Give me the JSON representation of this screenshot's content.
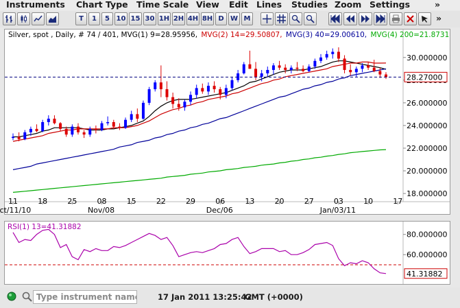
{
  "menu": {
    "items": [
      "Instruments",
      "Chart Type",
      "Time Scale",
      "View",
      "Edit",
      "Lines",
      "Studies",
      "Zoom",
      "Settings"
    ],
    "more": "»"
  },
  "toolbar": {
    "timeframes": [
      "T",
      "1",
      "5",
      "10",
      "15",
      "30",
      "1H",
      "2H",
      "4H",
      "8H",
      "D",
      "W",
      "M"
    ],
    "more": "»"
  },
  "chart_data": [
    {
      "type": "line",
      "subtype": "candlestick-with-moving-averages",
      "title": "Silver, spot , Daily, # 74 / 401",
      "legend": [
        {
          "text": "Silver, spot , Daily, # 74 / 401, MVG(1) 9=28.95956,",
          "color": "#000000"
        },
        {
          "text": "MVG(2) 14=29.50807,",
          "color": "#cc0000"
        },
        {
          "text": "MVG(3) 40=29.00610,",
          "color": "#000099"
        },
        {
          "text": "MVG(4) 200=21.87312",
          "color": "#00aa00"
        }
      ],
      "x_ticks": [
        {
          "major": "Oct/11/10",
          "minor": "11"
        },
        {
          "major": "",
          "minor": "18"
        },
        {
          "major": "",
          "minor": "25"
        },
        {
          "major": "Nov/08",
          "minor": "08"
        },
        {
          "major": "",
          "minor": "15"
        },
        {
          "major": "",
          "minor": "22"
        },
        {
          "major": "",
          "minor": "29"
        },
        {
          "major": "Dec/06",
          "minor": "06"
        },
        {
          "major": "",
          "minor": "13"
        },
        {
          "major": "",
          "minor": "20"
        },
        {
          "major": "",
          "minor": "27"
        },
        {
          "major": "Jan/03/11",
          "minor": "03"
        },
        {
          "major": "",
          "minor": "10"
        },
        {
          "major": "",
          "minor": "17"
        }
      ],
      "y_ticks": [
        "30.000000",
        "28.000000",
        "26.000000",
        "24.000000",
        "22.000000",
        "20.000000",
        "18.000000"
      ],
      "y_tick_values": [
        30,
        28,
        26,
        24,
        22,
        20,
        18
      ],
      "ylim": [
        17.4,
        31.5
      ],
      "last_price_label": "28.27000",
      "last_price": 28.27,
      "candle_colors": {
        "up": "#0000ff",
        "down": "#dd0000"
      },
      "candles": [
        [
          22.9,
          23.3,
          22.7,
          23.0
        ],
        [
          23.0,
          23.4,
          22.6,
          22.8
        ],
        [
          22.8,
          23.6,
          22.7,
          23.4
        ],
        [
          23.4,
          23.9,
          23.1,
          23.7
        ],
        [
          23.7,
          24.1,
          23.4,
          23.5
        ],
        [
          23.5,
          24.5,
          23.4,
          24.3
        ],
        [
          24.3,
          24.9,
          24.0,
          24.6
        ],
        [
          24.6,
          24.9,
          24.1,
          24.2
        ],
        [
          24.2,
          24.3,
          23.5,
          23.7
        ],
        [
          23.7,
          23.9,
          23.0,
          23.2
        ],
        [
          23.2,
          24.1,
          23.0,
          23.9
        ],
        [
          23.9,
          24.2,
          23.2,
          23.4
        ],
        [
          23.4,
          23.6,
          22.9,
          23.2
        ],
        [
          23.2,
          23.9,
          23.0,
          23.7
        ],
        [
          23.7,
          24.0,
          23.3,
          23.6
        ],
        [
          23.6,
          24.4,
          23.5,
          24.2
        ],
        [
          24.2,
          24.8,
          24.0,
          24.3
        ],
        [
          24.3,
          24.5,
          23.7,
          23.9
        ],
        [
          23.9,
          24.2,
          23.6,
          23.8
        ],
        [
          23.8,
          24.7,
          23.7,
          24.5
        ],
        [
          24.5,
          25.3,
          24.3,
          25.0
        ],
        [
          25.0,
          25.5,
          24.3,
          24.6
        ],
        [
          24.6,
          26.2,
          24.5,
          26.0
        ],
        [
          26.0,
          27.4,
          25.8,
          27.2
        ],
        [
          27.2,
          28.0,
          27.0,
          27.8
        ],
        [
          27.8,
          29.3,
          26.5,
          27.2
        ],
        [
          27.2,
          27.9,
          26.2,
          26.5
        ],
        [
          26.5,
          26.9,
          25.5,
          25.9
        ],
        [
          25.9,
          26.4,
          25.3,
          25.6
        ],
        [
          25.6,
          26.3,
          25.3,
          26.1
        ],
        [
          26.1,
          27.0,
          25.8,
          26.7
        ],
        [
          26.7,
          27.6,
          26.4,
          27.3
        ],
        [
          27.3,
          27.7,
          26.8,
          27.0
        ],
        [
          27.0,
          27.8,
          26.7,
          27.5
        ],
        [
          27.5,
          27.9,
          26.9,
          27.2
        ],
        [
          27.2,
          27.4,
          26.3,
          26.7
        ],
        [
          26.7,
          27.6,
          26.4,
          27.3
        ],
        [
          27.3,
          28.3,
          27.1,
          28.0
        ],
        [
          28.0,
          28.9,
          27.8,
          28.6
        ],
        [
          28.6,
          29.6,
          28.5,
          29.4
        ],
        [
          29.4,
          30.6,
          29.0,
          29.0
        ],
        [
          29.0,
          29.6,
          28.0,
          28.3
        ],
        [
          28.3,
          28.9,
          27.9,
          28.6
        ],
        [
          28.6,
          29.2,
          28.3,
          28.9
        ],
        [
          28.9,
          29.5,
          28.5,
          29.3
        ],
        [
          29.3,
          29.7,
          28.9,
          29.1
        ],
        [
          29.1,
          29.4,
          28.6,
          28.9
        ],
        [
          28.9,
          29.3,
          28.6,
          29.1
        ],
        [
          29.1,
          29.6,
          28.8,
          29.0
        ],
        [
          29.0,
          29.3,
          28.7,
          28.8
        ],
        [
          28.8,
          29.4,
          28.7,
          29.2
        ],
        [
          29.2,
          29.9,
          29.0,
          29.7
        ],
        [
          29.7,
          30.3,
          29.5,
          30.0
        ],
        [
          30.0,
          30.6,
          29.8,
          30.3
        ],
        [
          30.3,
          30.8,
          29.9,
          30.5
        ],
        [
          30.5,
          30.9,
          29.6,
          29.9
        ],
        [
          29.9,
          30.2,
          28.6,
          28.9
        ],
        [
          28.9,
          29.4,
          28.4,
          28.7
        ],
        [
          28.7,
          29.2,
          28.3,
          29.0
        ],
        [
          29.0,
          29.5,
          28.7,
          29.3
        ],
        [
          29.3,
          29.6,
          28.9,
          29.1
        ],
        [
          29.1,
          29.8,
          28.7,
          28.8
        ],
        [
          28.8,
          29.1,
          28.2,
          28.5
        ],
        [
          28.5,
          28.7,
          28.1,
          28.27
        ]
      ],
      "moving_averages": [
        {
          "name": "MVG(1) 9",
          "color": "#000000",
          "values": [
            23.0,
            23.0,
            23.1,
            23.2,
            23.3,
            23.5,
            23.6,
            23.8,
            23.8,
            23.8,
            23.8,
            23.8,
            23.7,
            23.6,
            23.6,
            23.6,
            23.7,
            23.7,
            23.8,
            23.9,
            24.0,
            24.2,
            24.4,
            24.8,
            25.3,
            25.7,
            26.0,
            26.2,
            26.3,
            26.3,
            26.3,
            26.4,
            26.5,
            26.6,
            26.7,
            26.8,
            26.9,
            27.1,
            27.3,
            27.5,
            27.8,
            27.9,
            28.1,
            28.3,
            28.5,
            28.7,
            28.8,
            28.9,
            28.9,
            28.9,
            29.0,
            29.1,
            29.2,
            29.4,
            29.6,
            29.7,
            29.7,
            29.6,
            29.5,
            29.4,
            29.3,
            29.2,
            29.1,
            28.96
          ]
        },
        {
          "name": "MVG(2) 14",
          "color": "#cc0000",
          "values": [
            22.6,
            22.7,
            22.8,
            22.9,
            23.0,
            23.1,
            23.3,
            23.4,
            23.5,
            23.6,
            23.6,
            23.7,
            23.7,
            23.7,
            23.7,
            23.7,
            23.7,
            23.8,
            23.8,
            23.8,
            23.9,
            24.0,
            24.2,
            24.4,
            24.7,
            25.0,
            25.2,
            25.4,
            25.5,
            25.7,
            25.8,
            26.0,
            26.1,
            26.3,
            26.4,
            26.5,
            26.6,
            26.8,
            26.9,
            27.1,
            27.3,
            27.5,
            27.7,
            27.8,
            28.0,
            28.1,
            28.3,
            28.4,
            28.5,
            28.6,
            28.7,
            28.8,
            28.9,
            29.0,
            29.2,
            29.3,
            29.4,
            29.5,
            29.5,
            29.6,
            29.6,
            29.5,
            29.5,
            29.51
          ]
        },
        {
          "name": "MVG(3) 40",
          "color": "#000099",
          "values": [
            20.1,
            20.2,
            20.3,
            20.4,
            20.6,
            20.7,
            20.8,
            20.9,
            21.0,
            21.1,
            21.2,
            21.3,
            21.4,
            21.5,
            21.6,
            21.7,
            21.8,
            21.9,
            22.1,
            22.2,
            22.3,
            22.5,
            22.6,
            22.7,
            22.9,
            23.0,
            23.2,
            23.3,
            23.5,
            23.6,
            23.8,
            23.9,
            24.1,
            24.2,
            24.4,
            24.6,
            24.7,
            24.9,
            25.1,
            25.3,
            25.5,
            25.7,
            25.9,
            26.1,
            26.3,
            26.5,
            26.6,
            26.8,
            27.0,
            27.2,
            27.3,
            27.5,
            27.6,
            27.8,
            27.9,
            28.1,
            28.2,
            28.4,
            28.5,
            28.6,
            28.7,
            28.8,
            28.9,
            29.0
          ]
        },
        {
          "name": "MVG(4) 200",
          "color": "#00aa00",
          "values": [
            18.1,
            18.15,
            18.2,
            18.25,
            18.3,
            18.35,
            18.4,
            18.45,
            18.5,
            18.55,
            18.6,
            18.65,
            18.7,
            18.75,
            18.8,
            18.85,
            18.9,
            18.95,
            19.0,
            19.05,
            19.1,
            19.15,
            19.2,
            19.25,
            19.3,
            19.35,
            19.45,
            19.5,
            19.55,
            19.6,
            19.7,
            19.75,
            19.8,
            19.9,
            19.95,
            20.0,
            20.1,
            20.15,
            20.2,
            20.3,
            20.35,
            20.4,
            20.5,
            20.55,
            20.6,
            20.7,
            20.75,
            20.85,
            20.9,
            21.0,
            21.05,
            21.15,
            21.2,
            21.3,
            21.35,
            21.45,
            21.5,
            21.6,
            21.65,
            21.7,
            21.75,
            21.8,
            21.85,
            21.87
          ]
        }
      ],
      "reference_lines": [
        {
          "value": 28.27,
          "color": "#000080",
          "style": "dashed"
        }
      ]
    },
    {
      "type": "line",
      "title": "RSI(1) 13=41.31882",
      "legend_color": "#aa00aa",
      "y_ticks": [
        "80.000000",
        "60.000000"
      ],
      "y_tick_values": [
        80,
        60
      ],
      "ylim": [
        33,
        90
      ],
      "last_value_label": "41.31882",
      "reference_lines": [
        {
          "value": 50,
          "color": "#cc0000",
          "style": "dashed"
        }
      ],
      "series": [
        {
          "name": "RSI(1) 13",
          "color": "#aa00aa",
          "values": [
            82,
            72,
            75,
            74,
            80,
            84,
            85,
            80,
            67,
            70,
            58,
            55,
            65,
            63,
            66,
            64,
            64,
            68,
            67,
            69,
            72,
            75,
            78,
            81,
            79,
            75,
            77,
            69,
            58,
            60,
            62,
            63,
            62,
            64,
            66,
            70,
            71,
            75,
            77,
            68,
            61,
            63,
            66,
            66,
            66,
            63,
            64,
            60,
            60,
            62,
            65,
            70,
            71,
            72,
            69,
            56,
            49,
            52,
            51,
            54,
            52,
            46,
            42,
            41.3
          ]
        }
      ]
    }
  ],
  "status": {
    "search_placeholder": "Type instrument name",
    "datetime": "17 Jan 2011 13:25:42",
    "tz": "GMT (+0000)"
  }
}
